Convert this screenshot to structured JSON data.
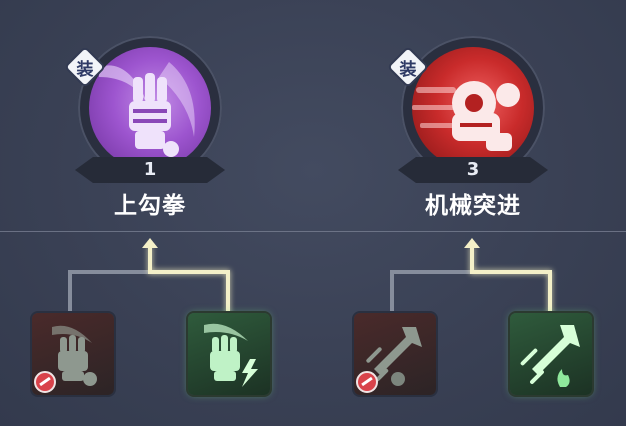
{
  "equip_badge_label": "装",
  "skills": [
    {
      "id": "uppercut",
      "name": "上勾拳",
      "level": "1",
      "color": "#9d55cf",
      "equipped": true
    },
    {
      "id": "mech-dash",
      "name": "机械突进",
      "level": "3",
      "color": "#c92b2b",
      "equipped": true
    }
  ],
  "upgrade_nodes": [
    {
      "parent": "uppercut",
      "icon": "fist-gauntlet-icon",
      "state": "locked"
    },
    {
      "parent": "uppercut",
      "icon": "fist-gauntlet-lightning-icon",
      "state": "active"
    },
    {
      "parent": "mech-dash",
      "icon": "dash-arrow-icon",
      "state": "locked"
    },
    {
      "parent": "mech-dash",
      "icon": "dash-arrow-flame-icon",
      "state": "active"
    }
  ],
  "colors": {
    "background": "#3a4155",
    "locked_path": "#868d9c",
    "active_path": "#f4f0c8",
    "active_node_glow": "#7ce68c",
    "lock_badge": "#d9434b"
  }
}
